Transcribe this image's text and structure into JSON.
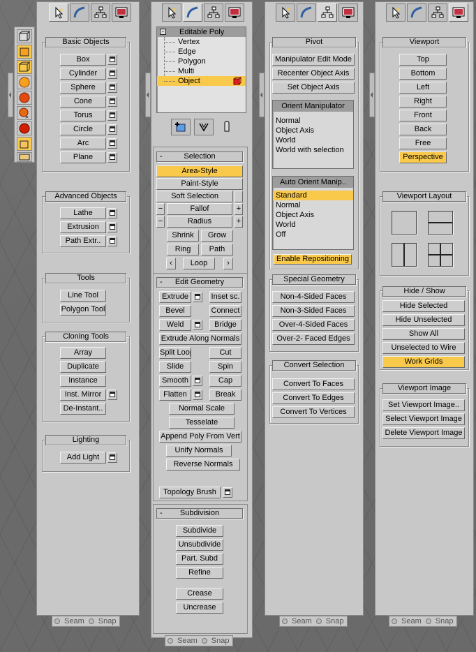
{
  "tabs": [
    "create-tab",
    "modify-tab",
    "hierarchy-tab",
    "display-tab"
  ],
  "colors": {
    "accent": "#f9c94c",
    "panel": "#c8c8c8"
  },
  "panel1": {
    "basic_title": "Basic Objects",
    "basic": [
      "Box",
      "Cylinder",
      "Sphere",
      "Cone",
      "Torus",
      "Circle",
      "Arc",
      "Plane"
    ],
    "advanced_title": "Advanced Objects",
    "advanced": [
      "Lathe",
      "Extrusion",
      "Path Extr.."
    ],
    "tools_title": "Tools",
    "tools": [
      "Line Tool",
      "Polygon Tool"
    ],
    "cloning_title": "Cloning Tools",
    "cloning": [
      "Array",
      "Duplicate",
      "Instance",
      "Inst. Mirror",
      "De-Instant.."
    ],
    "lighting_title": "Lighting",
    "lighting": [
      "Add Light"
    ]
  },
  "panel2": {
    "stack_title": "Editable Poly",
    "stack_items": [
      "Vertex",
      "Edge",
      "Polygon",
      "Multi",
      "Object"
    ],
    "selection_title": "Selection",
    "area_style": "Area-Style",
    "paint_style": "Paint-Style",
    "soft_selection": "Soft Selection",
    "falloff": "Fallof",
    "radius": "Radius",
    "shrink": "Shrink",
    "grow": "Grow",
    "ring": "Ring",
    "path": "Path",
    "loop": "Loop",
    "edit_title": "Edit Geometry",
    "extrude": "Extrude",
    "inset": "Inset sc.",
    "bevel": "Bevel",
    "connect": "Connect",
    "weld": "Weld",
    "bridge": "Bridge",
    "extrude_normals": "Extrude Along Normals",
    "split_loop": "Split Loop",
    "cut": "Cut",
    "slide": "Slide",
    "spin": "Spin",
    "smooth": "Smooth",
    "cap": "Cap",
    "flatten": "Flatten",
    "break": "Break",
    "normal_scale": "Normal Scale",
    "tesselate": "Tesselate",
    "append_poly": "Append Poly From Vert",
    "unify_normals": "Unify Normals",
    "reverse_normals": "Reverse Normals",
    "topology_brush": "Topology Brush",
    "subdivision_title": "Subdivision",
    "subdivide": "Subdivide",
    "unsubdivide": "Unsubdivide",
    "part_subd": "Part. Subd",
    "refine": "Refine",
    "crease": "Crease",
    "uncrease": "Uncrease"
  },
  "panel3": {
    "pivot_title": "Pivot",
    "pivot": [
      "Manipulator Edit Mode",
      "Recenter Object Axis",
      "Set Object Axis"
    ],
    "orient_title": "Orient Manipulator",
    "orient": [
      "Normal",
      "Object Axis",
      "World",
      "World with selection"
    ],
    "auto_title": "Auto Orient Manip..",
    "auto": [
      "Standard",
      "Normal",
      "Object Axis",
      "World",
      "Off"
    ],
    "enable_repositioning": "Enable Repositioning",
    "special_title": "Special Geometry",
    "special": [
      "Non-4-Sided Faces",
      "Non-3-Sided Faces",
      "Over-4-Sided Faces",
      "Over-2- Faced Edges"
    ],
    "convert_title": "Convert Selection",
    "convert": [
      "Convert To Faces",
      "Convert To Edges",
      "Convert To Vertices"
    ]
  },
  "panel4": {
    "viewport_title": "Viewport",
    "viewport": [
      "Top",
      "Bottom",
      "Left",
      "Right",
      "Front",
      "Back",
      "Free",
      "Perspective"
    ],
    "layout_title": "Viewport Layout",
    "hide_title": "Hide / Show",
    "hide": [
      "Hide Selected",
      "Hide Unselected",
      "Show All",
      "Unselected to Wire",
      "Work Grids"
    ],
    "image_title": "Viewport Image",
    "image": [
      "Set Viewport Image..",
      "Select Viewport Image",
      "Delete Viewport Image"
    ]
  },
  "bottom": {
    "seam": "Seam",
    "snap": "Snap"
  }
}
